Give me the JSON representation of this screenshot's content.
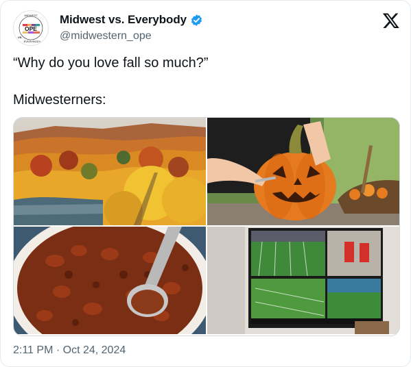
{
  "author": {
    "display_name": "Midwest vs. Everybody",
    "handle": "@midwestern_ope",
    "avatar_text": "OPE",
    "avatar_ring_top": "MIDWEST",
    "avatar_ring_bottom": "EVERYBODY",
    "avatar_vs": "VS."
  },
  "tweet": {
    "line1": "“Why do you love fall so much?”",
    "line2": "Midwesterners:"
  },
  "media": {
    "tiles": [
      "fall-foliage-landscape",
      "pumpkin-carving",
      "bowl-of-chili",
      "football-on-tv-screens"
    ]
  },
  "meta": {
    "time": "2:11 PM",
    "separator": " · ",
    "date": "Oct 24, 2024"
  },
  "colors": {
    "verified_blue": "#1d9bf0",
    "secondary_text": "#536471",
    "border": "#e6e9ec"
  },
  "icons": {
    "verified": "verified-badge-icon",
    "platform": "x-logo-icon"
  }
}
